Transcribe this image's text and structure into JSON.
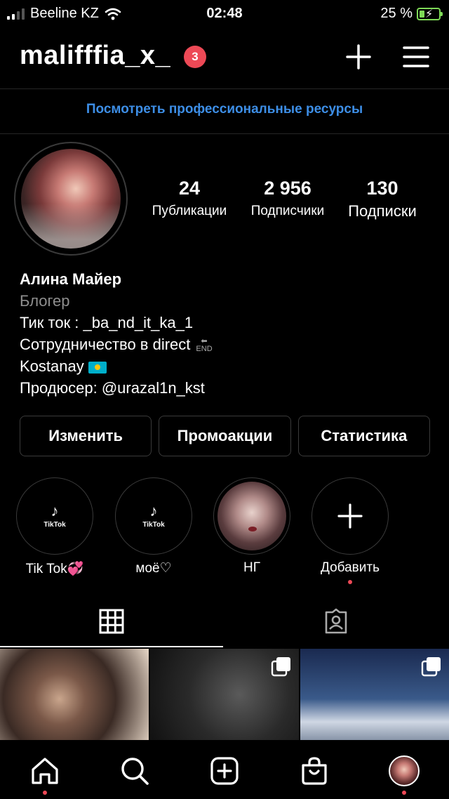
{
  "status_bar": {
    "carrier": "Beeline KZ",
    "time": "02:48",
    "battery_percent": "25 %",
    "battery_level": 0.25
  },
  "header": {
    "username": "malifffia_x_",
    "notification_count": "3"
  },
  "professional_link": "Посмотреть профессиональные ресурсы",
  "profile": {
    "stats": [
      {
        "value": "24",
        "label": "Публикации"
      },
      {
        "value": "2 956",
        "label": "Подписчики"
      },
      {
        "value": "130",
        "label": "Подписки"
      }
    ],
    "name": "Алина Майер",
    "category": "Блогер",
    "bio_lines": [
      "Тик ток : _ba_nd_it_ka_1",
      "Сотрудничество в direct",
      "Kostanay",
      "Продюсер: @urazal1n_kst"
    ],
    "end_icon_text": "END"
  },
  "buttons": {
    "edit": "Изменить",
    "promo": "Промоакции",
    "stats": "Статистика"
  },
  "highlights": [
    {
      "label": "Tik Tok💞",
      "cover_text": "TikTok"
    },
    {
      "label": "моё♡",
      "cover_text": "TikTok"
    },
    {
      "label": "НГ"
    },
    {
      "label": "Добавить"
    }
  ],
  "colors": {
    "accent_blue": "#3d8ee6",
    "notification_red": "#ed4956",
    "battery_green": "#7ed957",
    "background": "#000000"
  },
  "icons": {
    "header": [
      "plus-icon",
      "menu-icon"
    ],
    "tabs": [
      "grid-icon",
      "tagged-icon"
    ],
    "nav": [
      "home-icon",
      "search-icon",
      "create-icon",
      "shop-icon",
      "profile-avatar"
    ]
  }
}
